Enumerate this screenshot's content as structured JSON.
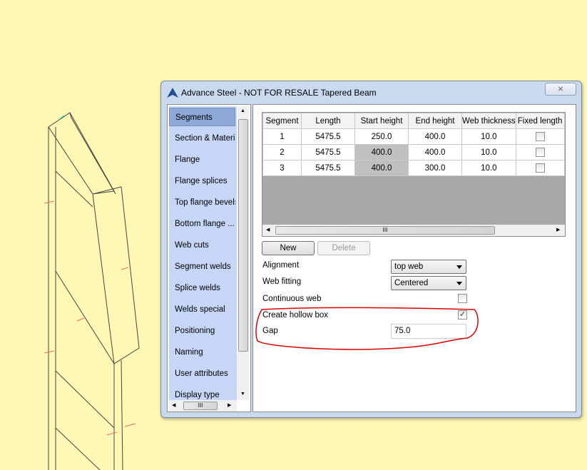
{
  "dialog": {
    "title": "Advance Steel - NOT FOR RESALE  Tapered Beam",
    "close_label": "⨯"
  },
  "nav": {
    "items": [
      {
        "label": "Segments",
        "selected": true
      },
      {
        "label": "Section & Material"
      },
      {
        "label": "Flange"
      },
      {
        "label": "Flange splices"
      },
      {
        "label": "Top flange bevels"
      },
      {
        "label": "Bottom flange ..."
      },
      {
        "label": "Web cuts"
      },
      {
        "label": "Segment welds"
      },
      {
        "label": "Splice welds"
      },
      {
        "label": "Welds special"
      },
      {
        "label": "Positioning"
      },
      {
        "label": "Naming"
      },
      {
        "label": "User attributes"
      },
      {
        "label": "Display type"
      }
    ]
  },
  "table": {
    "headers": [
      "Segment",
      "Length",
      "Start height",
      "End height",
      "Web thickness",
      "Fixed length"
    ],
    "rows": [
      [
        "1",
        "5475.5",
        "250.0",
        "400.0",
        "10.0",
        false
      ],
      [
        "2",
        "5475.5",
        "400.0",
        "400.0",
        "10.0",
        false
      ],
      [
        "3",
        "5475.5",
        "400.0",
        "300.0",
        "10.0",
        false
      ]
    ]
  },
  "scroll_grip": "III",
  "buttons": {
    "new": "New",
    "delete": "Delete"
  },
  "form": {
    "alignment_label": "Alignment",
    "alignment_value": "top web",
    "web_fitting_label": "Web fitting",
    "web_fitting_value": "Centered",
    "continuous_web_label": "Continuous web",
    "continuous_web": false,
    "hollow_box_label": "Create hollow box",
    "hollow_box": true,
    "gap_label": "Gap",
    "gap_value": "75.0"
  },
  "colors": {
    "background": "#fff7b4",
    "annotation": "#e00000",
    "nav": "#c6d6f6"
  }
}
